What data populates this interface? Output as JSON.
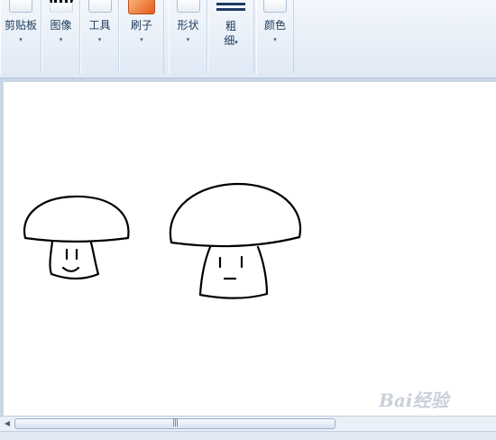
{
  "ribbon": {
    "groups": [
      {
        "label": "剪贴板",
        "icon": "clipboard-icon"
      },
      {
        "label": "图像",
        "icon": "image-select-icon"
      },
      {
        "label": "工具",
        "icon": "tools-icon"
      },
      {
        "label": "刷子",
        "icon": "brush-icon"
      },
      {
        "label": "形状",
        "icon": "shapes-icon"
      },
      {
        "label": "颜色",
        "icon": "color-icon"
      }
    ],
    "size": {
      "line1": "粗",
      "line2": "细",
      "icon": "line-width-icon"
    },
    "dropdown_glyph": "▾"
  },
  "scrollbar": {
    "left_arrow": "◀",
    "grip": "|||"
  },
  "watermark": "Bai经验",
  "colors": {
    "ribbon_text": "#1e395b",
    "canvas": "#ffffff",
    "stroke": "#000000"
  }
}
